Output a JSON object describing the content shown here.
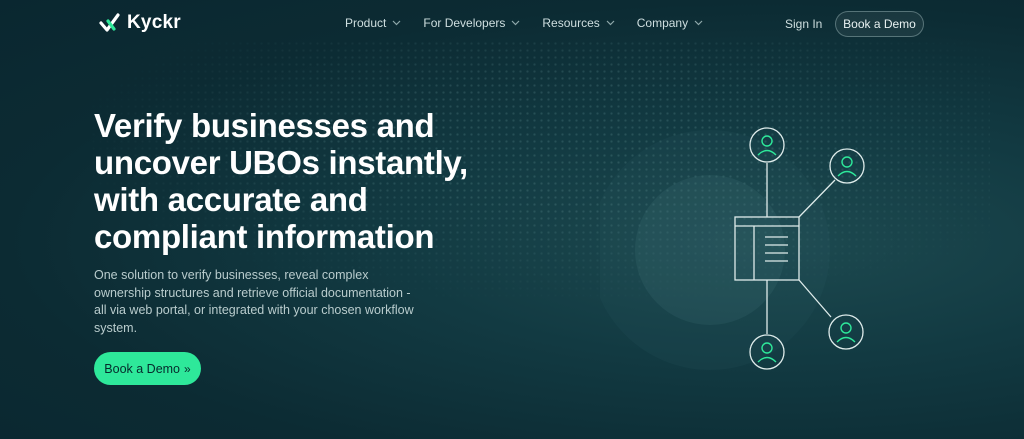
{
  "brand": {
    "name": "Kyckr"
  },
  "nav": {
    "items": [
      {
        "label": "Product"
      },
      {
        "label": "For Developers"
      },
      {
        "label": "Resources"
      },
      {
        "label": "Company"
      }
    ],
    "sign_in": "Sign In",
    "book_demo": "Book a Demo"
  },
  "hero": {
    "title": "Verify businesses and uncover UBOs instantly, with accurate and compliant information",
    "subtitle": "One solution to verify businesses, reveal complex ownership structures and retrieve official documentation - all via web portal, or integrated with your chosen workflow system.",
    "cta_label": "Book a Demo",
    "cta_icon": "double-chevron-right-icon"
  },
  "colors": {
    "accent": "#2ee89a",
    "background": "#0c2b33",
    "line": "#dfeceb"
  },
  "illustration": {
    "icons": [
      "user-icon",
      "user-icon",
      "user-icon",
      "user-icon",
      "document-icon"
    ]
  }
}
